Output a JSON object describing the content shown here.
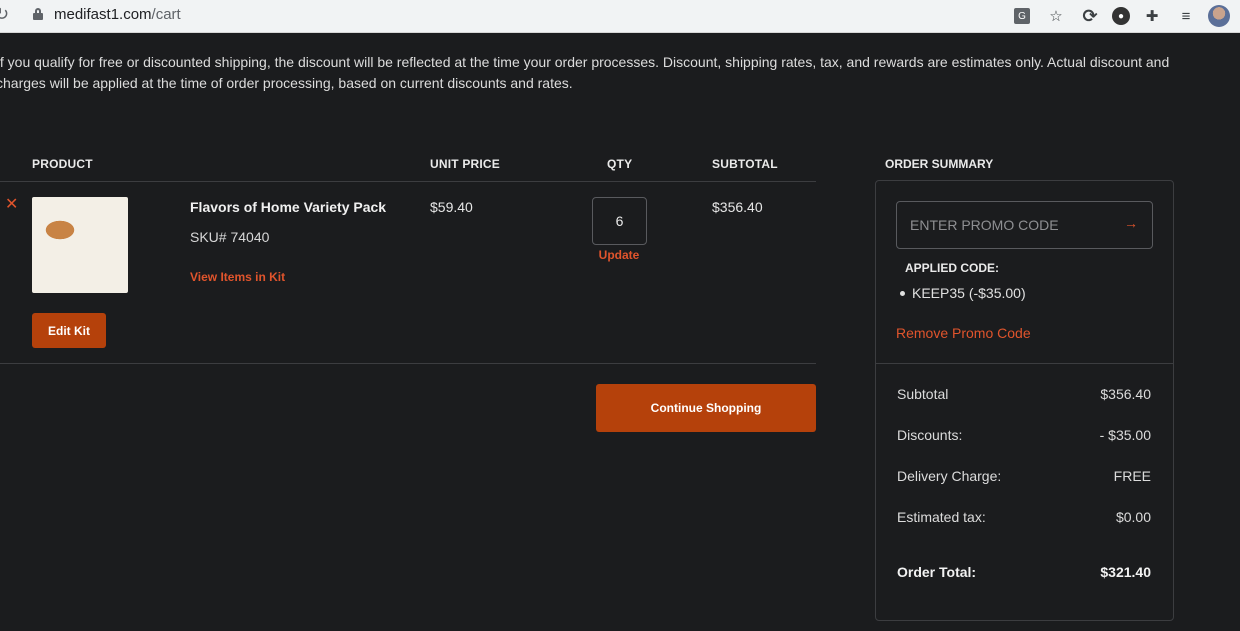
{
  "browser": {
    "url_host": "medifast1.com",
    "url_path": "/cart"
  },
  "notice": {
    "text": "If you qualify for free or discounted shipping, the discount will be reflected at the time your order processes. Discount, shipping rates, tax, and rewards are estimates only. Actual discount and charges will be applied at the time of order processing, based on current discounts and rates."
  },
  "table": {
    "headers": {
      "product": "PRODUCT",
      "unit_price": "UNIT PRICE",
      "qty": "QTY",
      "subtotal": "SUBTOTAL"
    }
  },
  "item": {
    "remove_glyph": "✕",
    "name": "Flavors of Home Variety Pack",
    "sku": "SKU# 74040",
    "view_items_label": "View Items in Kit",
    "edit_kit_label": "Edit Kit",
    "unit_price": "$59.40",
    "qty": "6",
    "update_label": "Update",
    "subtotal": "$356.40"
  },
  "continue_label": "Continue Shopping",
  "order_summary": {
    "title": "ORDER SUMMARY",
    "promo_placeholder": "ENTER PROMO CODE",
    "applied_label": "APPLIED CODE:",
    "applied_code": "KEEP35 (-$35.00)",
    "remove_promo_label": "Remove Promo Code",
    "rows": [
      {
        "label": "Subtotal",
        "value": "$356.40"
      },
      {
        "label": "Discounts:",
        "value": "- $35.00"
      },
      {
        "label": "Delivery Charge:",
        "value": "FREE"
      },
      {
        "label": "Estimated tax:",
        "value": "$0.00"
      }
    ],
    "total": {
      "label": "Order Total:",
      "value": "$321.40"
    }
  },
  "colors": {
    "accent": "#e0542c",
    "button": "#b5410b",
    "background": "#1b1c1e"
  }
}
